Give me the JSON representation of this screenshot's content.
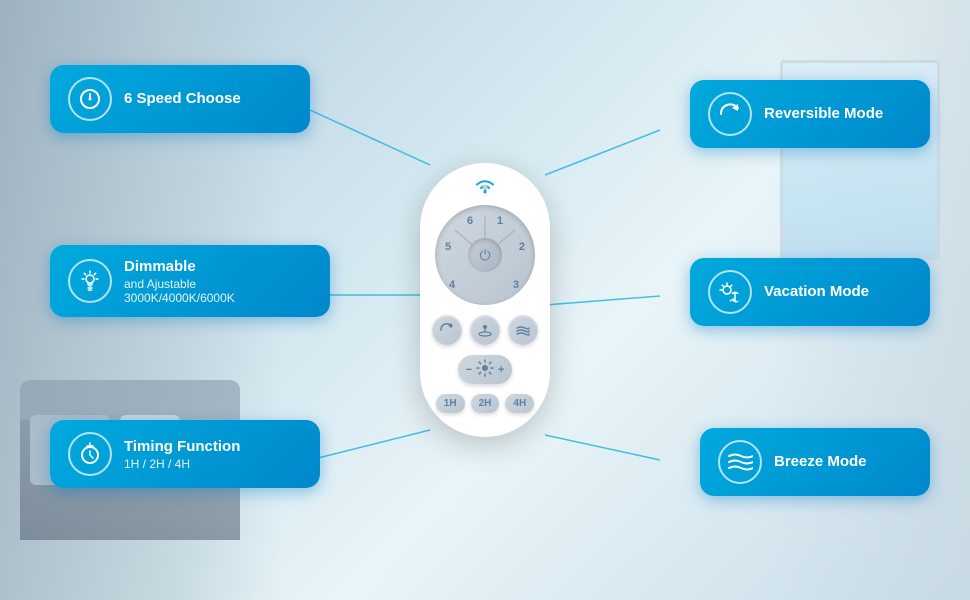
{
  "background": {
    "color_left": "#8a9aa8",
    "color_right": "#c8d8e0",
    "color_center": "#d4e8f0"
  },
  "features": {
    "speed": {
      "title": "6 Speed Choose",
      "icon": "power"
    },
    "dimmer": {
      "title": "Dimmable",
      "subtitle1": "and Ajustable",
      "subtitle2": "3000K/4000K/6000K",
      "icon": "bulb"
    },
    "timing": {
      "title": "Timing Function",
      "subtitle": "1H / 2H / 4H",
      "icon": "timer"
    },
    "reversible": {
      "title": "Reversible Mode",
      "icon": "reverse"
    },
    "vacation": {
      "title": "Vacation Mode",
      "icon": "vacation"
    },
    "breeze": {
      "title": "Breeze Mode",
      "icon": "breeze"
    }
  },
  "remote": {
    "speeds": [
      "6",
      "5",
      "4",
      "3",
      "2",
      "1"
    ],
    "buttons": [
      "reverse",
      "vacation",
      "breeze"
    ],
    "timers": [
      "1H",
      "2H",
      "4H"
    ],
    "wifi": "≋"
  }
}
